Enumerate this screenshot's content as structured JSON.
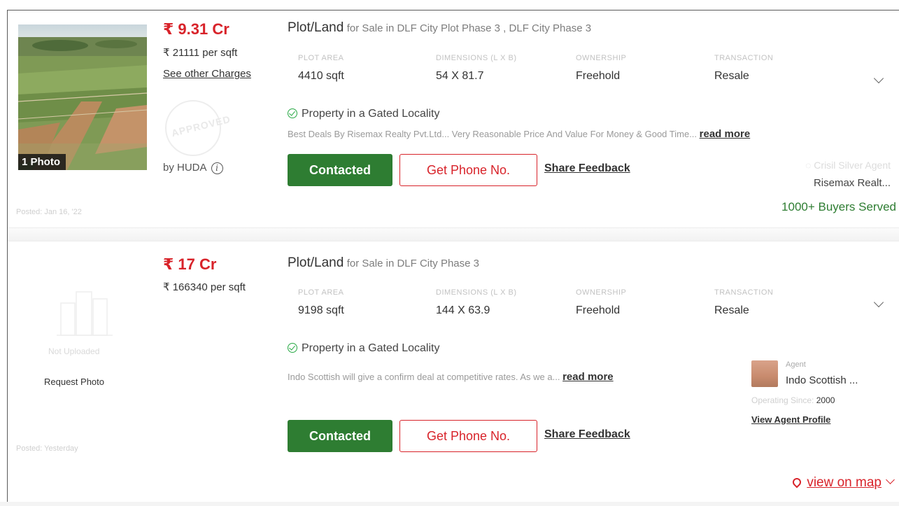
{
  "listings": [
    {
      "price": "₹ 9.31 Cr",
      "price_per_sqft": "₹ 21111 per sqft",
      "other_charges": "See other Charges",
      "title_main": "Plot/Land",
      "title_sub": "for Sale in DLF City Plot Phase 3 , DLF City Phase 3",
      "attributes": [
        {
          "label": "PLOT AREA",
          "value": "4410 sqft"
        },
        {
          "label": "DIMENSIONS (L X B)",
          "value": "54 X 81.7"
        },
        {
          "label": "OWNERSHIP",
          "value": "Freehold"
        },
        {
          "label": "TRANSACTION",
          "value": "Resale"
        }
      ],
      "gated": "Property in a Gated Locality",
      "description": "Best Deals By Risemax Realty Pvt.Ltd... Very Reasonable Price And Value For Money & Good Time...",
      "read_more": "read more",
      "photo_badge": "1 Photo",
      "stamp_text": "APPROVED",
      "approved_by": "by HUDA",
      "contacted_label": "Contacted",
      "phone_label": "Get Phone No.",
      "feedback_label": "Share Feedback",
      "agent_badge": "Crisil Silver Agent",
      "agent_name": "Risemax Realt...",
      "buyers_served": "1000+ Buyers Served",
      "posted": "Posted: Jan 16, '22"
    },
    {
      "price": "₹ 17 Cr",
      "price_per_sqft": "₹ 166340 per sqft",
      "title_main": "Plot/Land",
      "title_sub": "for Sale in DLF City Phase 3",
      "attributes": [
        {
          "label": "PLOT AREA",
          "value": "9198 sqft"
        },
        {
          "label": "DIMENSIONS (L X B)",
          "value": "144 X 63.9"
        },
        {
          "label": "OWNERSHIP",
          "value": "Freehold"
        },
        {
          "label": "TRANSACTION",
          "value": "Resale"
        }
      ],
      "gated": "Property in a Gated Locality",
      "description": "Indo Scottish will give a confirm deal at competitive rates. As we a...",
      "read_more": "read more",
      "not_uploaded": "Not Uploaded",
      "request_photo": "Request Photo",
      "contacted_label": "Contacted",
      "phone_label": "Get Phone No.",
      "feedback_label": "Share Feedback",
      "agent_label": "Agent",
      "agent_name": "Indo Scottish ...",
      "operating_since_label": "Operating Since:",
      "operating_since_year": "2000",
      "agent_profile_link": "View Agent Profile",
      "posted": "Posted: Yesterday",
      "map_link": "view on map"
    }
  ],
  "colors": {
    "price_red": "#d8232a",
    "contacted_green": "#2e7d32",
    "check_green": "#27a844"
  }
}
